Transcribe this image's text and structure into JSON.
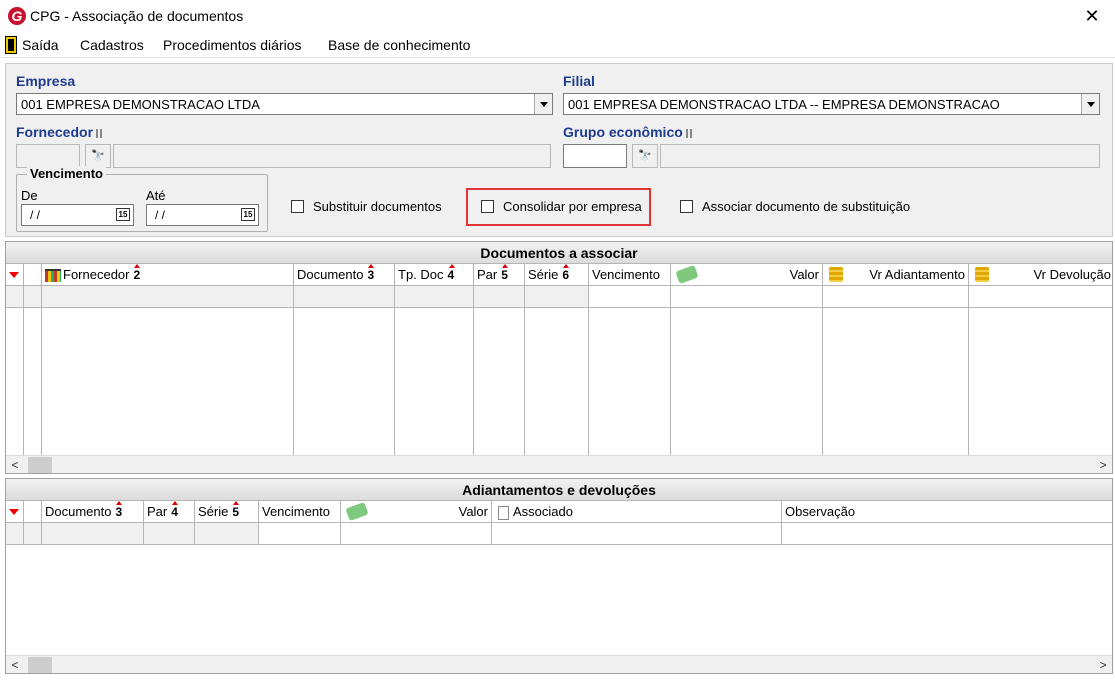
{
  "window": {
    "title": "CPG - Associação de documentos",
    "close_label": "✕"
  },
  "menu": {
    "items": [
      "Saída",
      "Cadastros",
      "Procedimentos diários",
      "Base de conhecimento"
    ]
  },
  "filters": {
    "empresa_label": "Empresa",
    "empresa_value": "001 EMPRESA DEMONSTRACAO LTDA",
    "filial_label": "Filial",
    "filial_value": "001 EMPRESA DEMONSTRACAO LTDA -- EMPRESA DEMONSTRACAO",
    "fornecedor_label": "Fornecedor",
    "grupo_label": "Grupo econômico",
    "vencimento_label": "Vencimento",
    "de_label": "De",
    "ate_label": "Até",
    "de_value": "/ /",
    "ate_value": "/ /",
    "calendar_glyph": "15",
    "binoc_glyph": "🔭"
  },
  "options": {
    "substituir": "Substituir documentos",
    "consolidar": "Consolidar por empresa",
    "associar": "Associar documento de substituição"
  },
  "grid1": {
    "caption": "Documentos a associar",
    "columns": {
      "fornecedor": "Fornecedor",
      "fornecedor_sort": "2",
      "documento": "Documento",
      "documento_sort": "3",
      "tpdoc": "Tp. Doc",
      "tpdoc_sort": "4",
      "par": "Par",
      "par_sort": "5",
      "serie": "Série",
      "serie_sort": "6",
      "vencimento": "Vencimento",
      "valor": "Valor",
      "vr_adiantamento": "Vr Adiantamento",
      "vr_devolucao": "Vr Devolução"
    }
  },
  "grid2": {
    "caption": "Adiantamentos e devoluções",
    "columns": {
      "documento": "Documento",
      "documento_sort": "3",
      "par": "Par",
      "par_sort": "4",
      "serie": "Série",
      "serie_sort": "5",
      "vencimento": "Vencimento",
      "valor": "Valor",
      "associado": "Associado",
      "observacao": "Observação"
    }
  },
  "scroll": {
    "left": "<",
    "right": ">"
  },
  "colors": {
    "label_blue": "#1f3b8f",
    "highlight_red": "#e03333",
    "logo_red": "#c8102e"
  }
}
